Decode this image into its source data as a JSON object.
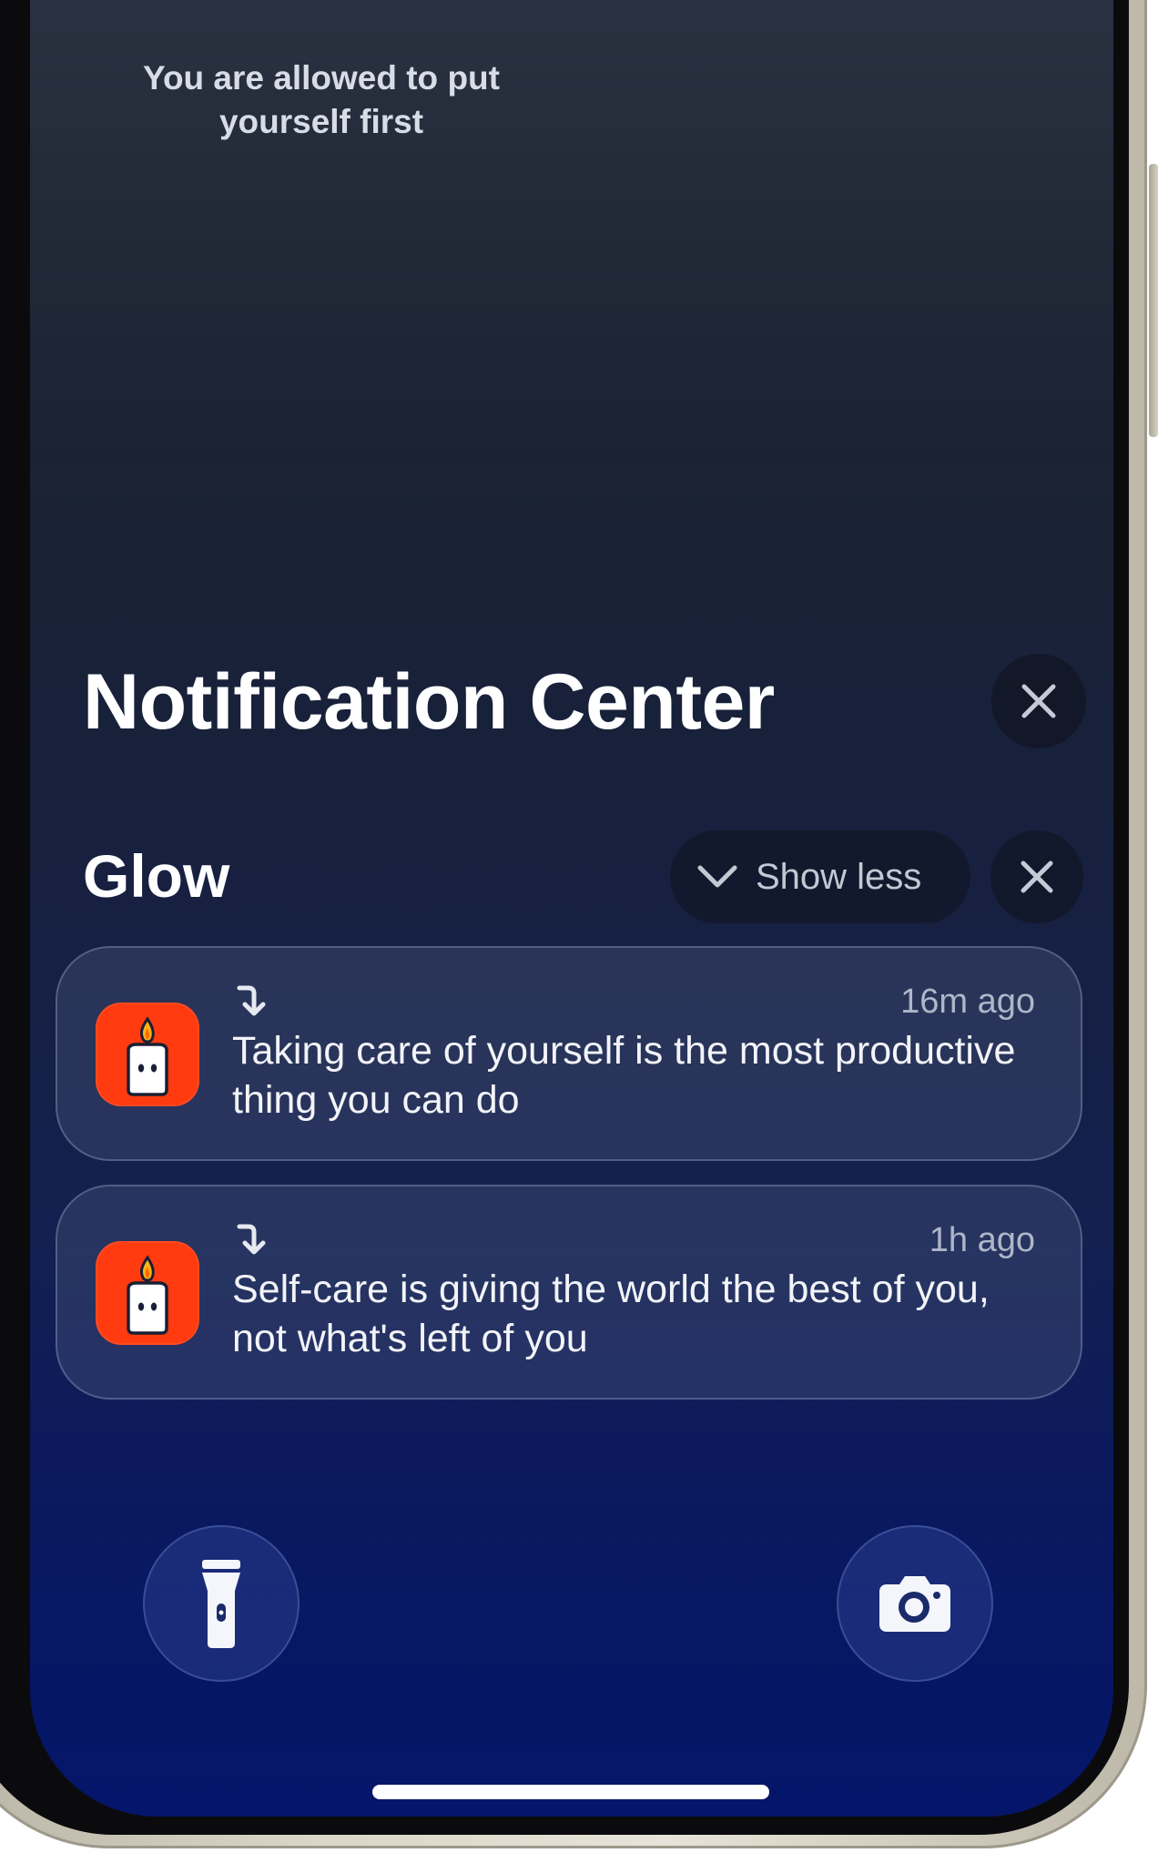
{
  "lock_screen": {
    "quote": "You are allowed to put\nyourself first"
  },
  "notification_center": {
    "title": "Notification Center",
    "close_icon": "close-icon"
  },
  "group": {
    "app_name": "Glow",
    "show_less_label": "Show less",
    "chevron_icon": "chevron-down-icon",
    "close_icon": "close-icon"
  },
  "notifications": [
    {
      "app_icon": "candle-icon",
      "indicator_icon": "redirect-arrow-icon",
      "time": "16m ago",
      "body": "Taking care of yourself is the most productive thing you can do"
    },
    {
      "app_icon": "candle-icon",
      "indicator_icon": "redirect-arrow-icon",
      "time": "1h ago",
      "body": "Self-care is giving the world the best of you, not what's left of you"
    }
  ],
  "quick_actions": {
    "left_icon": "flashlight-icon",
    "right_icon": "camera-icon"
  },
  "colors": {
    "app_icon_bg": "#ff3b0f",
    "screen_top": "#2a3140",
    "screen_bottom": "#05156a"
  }
}
